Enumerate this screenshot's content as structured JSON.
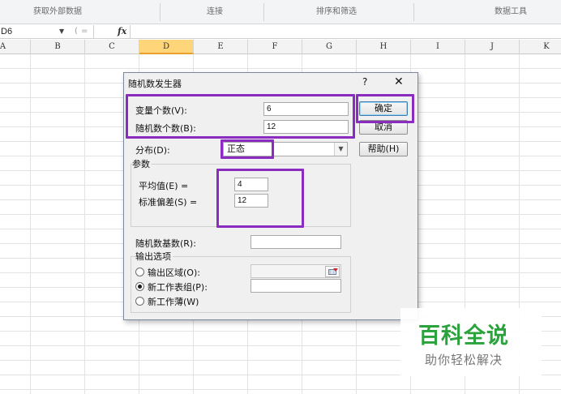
{
  "ribbon": {
    "groups": [
      "获取外部数据",
      "连接",
      "排序和筛选",
      "数据工具"
    ]
  },
  "formula_bar": {
    "name_box": "D6",
    "fx_label": "fx"
  },
  "columns": [
    "A",
    "B",
    "C",
    "D",
    "E",
    "F",
    "G",
    "H",
    "I",
    "J",
    "K"
  ],
  "selected_column": "D",
  "dialog": {
    "title": "随机数发生器",
    "help_symbol": "?",
    "close_symbol": "✕",
    "variables_label": "变量个数(V):",
    "variables_value": "6",
    "count_label": "随机数个数(B):",
    "count_value": "12",
    "distribution_label": "分布(D):",
    "distribution_value": "正态",
    "params_label": "参数",
    "mean_label": "平均值(E) =",
    "mean_value": "4",
    "stdev_label": "标准偏差(S) =",
    "stdev_value": "12",
    "seed_label": "随机数基数(R):",
    "seed_value": "",
    "output_label": "输出选项",
    "output_range_label": "输出区域(O):",
    "output_range_value": "",
    "new_sheet_label": "新工作表组(P):",
    "new_sheet_value": "",
    "new_workbook_label": "新工作薄(W)",
    "ok_button": "确定",
    "cancel_button": "取消",
    "help_button": "帮助(H)",
    "selected_output": "new_sheet"
  },
  "annotation_color": "#8a2cc0",
  "watermark": {
    "title": "百科全说",
    "subtitle": "助你轻松解决",
    "color": "#2aa33c"
  }
}
